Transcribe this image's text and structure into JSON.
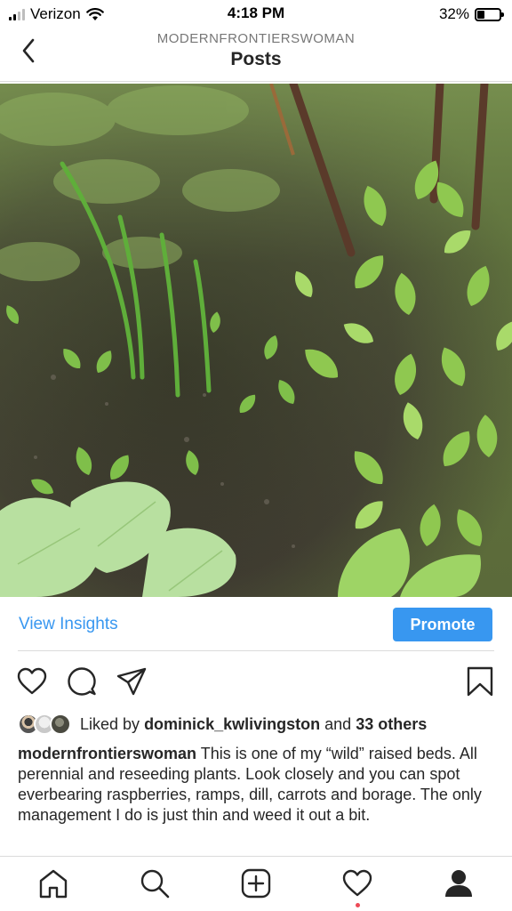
{
  "status_bar": {
    "carrier": "Verizon",
    "time": "4:18 PM",
    "battery_percent": "32%",
    "battery_level": 0.32,
    "signal_bars": 4,
    "signal_bars_filled": 2
  },
  "header": {
    "username": "MODERNFRONTIERSWOMAN",
    "title": "Posts",
    "back_icon": "chevron-left-icon"
  },
  "post": {
    "image_alt": "Raised garden bed with raspberries, ramps, dill, carrots and borage",
    "insights_label": "View Insights",
    "promote_label": "Promote",
    "actions": [
      "heart-icon",
      "comment-icon",
      "share-icon",
      "bookmark-icon"
    ],
    "likes": {
      "prefix": "Liked by",
      "user": "dominick_kwlivingston",
      "connector": "and",
      "others": "33 others"
    },
    "caption": {
      "username": "modernfrontierswoman",
      "text": "This is one of my “wild” raised beds. All perennial and reseeding plants. Look closely and you can spot everbearing raspberries, ramps, dill, carrots and borage. The only management I do is just thin and weed it out a bit."
    }
  },
  "tab_bar": {
    "tabs": [
      "home-icon",
      "search-icon",
      "new-post-icon",
      "activity-icon",
      "profile-icon"
    ],
    "activity_notification": true
  },
  "colors": {
    "accent": "#3897f0",
    "text": "#262626",
    "muted": "#777777",
    "divider": "#dbdbdb",
    "notification": "#ed4956"
  }
}
